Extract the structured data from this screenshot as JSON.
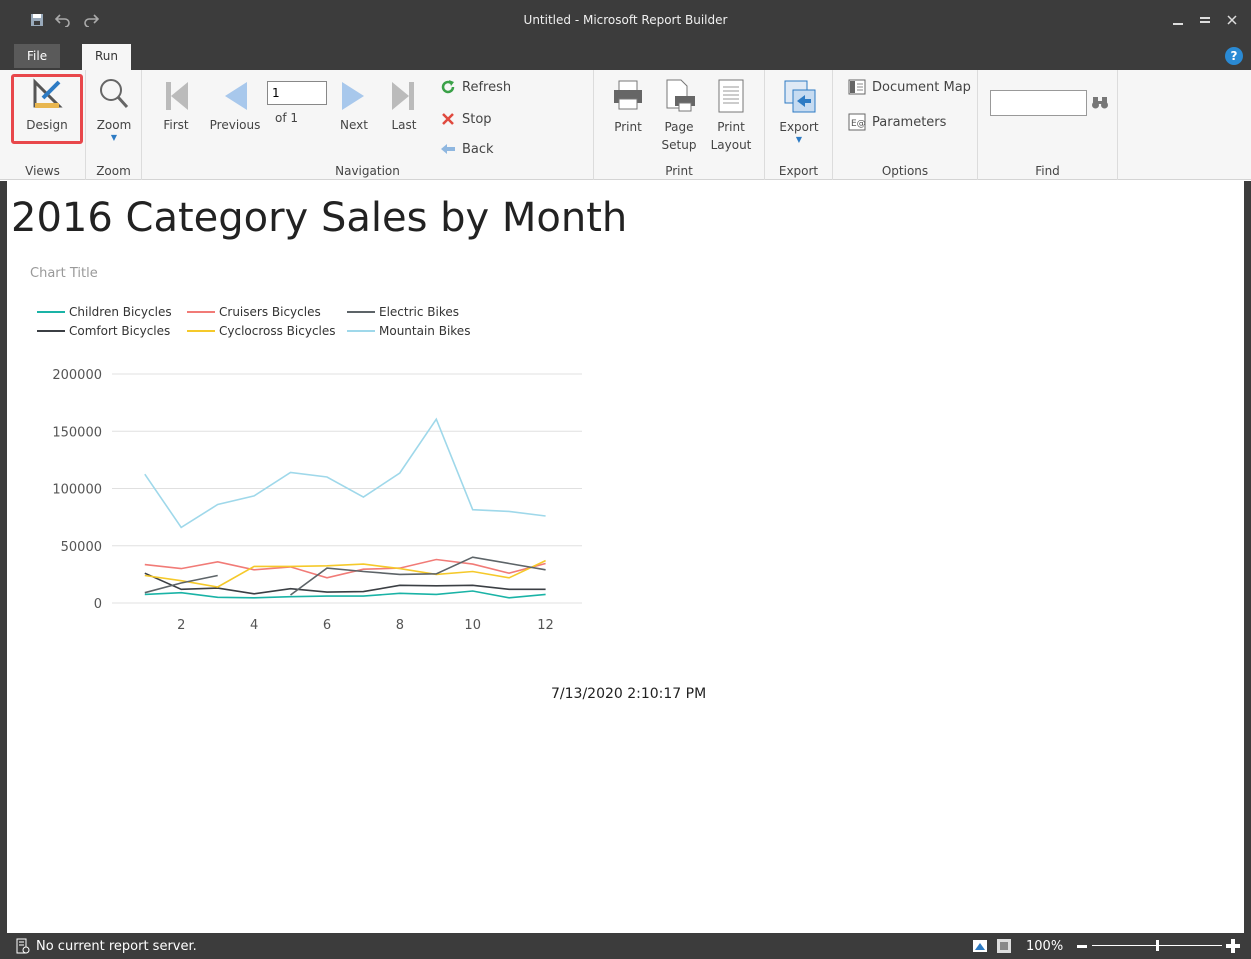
{
  "window": {
    "title": "Untitled - Microsoft Report Builder"
  },
  "tabs": [
    {
      "label": "File"
    },
    {
      "label": "Run"
    }
  ],
  "ribbon": {
    "views": {
      "group_label": "Views",
      "design_label": "Design"
    },
    "zoom": {
      "group_label": "Zoom",
      "zoom_label": "Zoom"
    },
    "navigation": {
      "group_label": "Navigation",
      "first_label": "First",
      "previous_label": "Previous",
      "page_value": "1",
      "of_label": "of  1",
      "next_label": "Next",
      "last_label": "Last",
      "refresh_label": "Refresh",
      "stop_label": "Stop",
      "back_label": "Back"
    },
    "print": {
      "group_label": "Print",
      "print_label": "Print",
      "page_setup_label": "Page Setup",
      "print_layout_label": "Print Layout"
    },
    "export": {
      "group_label": "Export",
      "export_label": "Export"
    },
    "options": {
      "group_label": "Options",
      "document_map_label": "Document Map",
      "parameters_label": "Parameters"
    },
    "find": {
      "group_label": "Find",
      "find_value": ""
    }
  },
  "report": {
    "title": "2016 Category Sales by Month",
    "timestamp": "7/13/2020 2:10:17 PM"
  },
  "chart_data": {
    "type": "line",
    "title": "Chart Title",
    "xlabel": "",
    "ylabel": "",
    "x": [
      1,
      2,
      3,
      4,
      5,
      6,
      7,
      8,
      9,
      10,
      11,
      12
    ],
    "xticks": [
      2,
      4,
      6,
      8,
      10,
      12
    ],
    "xlim": [
      0.1,
      13
    ],
    "yticks": [
      0,
      50000,
      100000,
      150000,
      200000
    ],
    "ylim": [
      0,
      200000
    ],
    "grid": true,
    "legend_position": "top-left",
    "series": [
      {
        "name": "Children Bicycles",
        "color": "#1ab3a6",
        "values": [
          7500,
          9000,
          5000,
          4500,
          5500,
          6000,
          6000,
          8500,
          7500,
          10500,
          4500,
          7500
        ]
      },
      {
        "name": "Comfort Bicycles",
        "color": "#3b3f44",
        "values": [
          26000,
          12000,
          13000,
          8000,
          12500,
          9500,
          10000,
          15500,
          15000,
          15500,
          12000,
          12000
        ]
      },
      {
        "name": "Cruisers Bicycles",
        "color": "#f17b77",
        "values": [
          33500,
          30000,
          36000,
          29000,
          31500,
          22000,
          29500,
          30500,
          38000,
          34000,
          26000,
          34500
        ]
      },
      {
        "name": "Cyclocross Bicycles",
        "color": "#f5c92a",
        "values": [
          24000,
          19500,
          14000,
          32000,
          32000,
          32500,
          34000,
          30000,
          25000,
          27500,
          22000,
          37000
        ]
      },
      {
        "name": "Electric Bikes",
        "color": "#5d6468",
        "values": [
          9000,
          17500,
          24000,
          null,
          7000,
          30500,
          27500,
          25000,
          25500,
          40000,
          34500,
          29000
        ]
      },
      {
        "name": "Mountain Bikes",
        "color": "#9fd8ea",
        "values": [
          112500,
          66000,
          86000,
          93500,
          114000,
          110000,
          92500,
          113500,
          160500,
          81500,
          80000,
          76000
        ]
      }
    ]
  },
  "status": {
    "text": "No current report server.",
    "zoom": "100%"
  }
}
